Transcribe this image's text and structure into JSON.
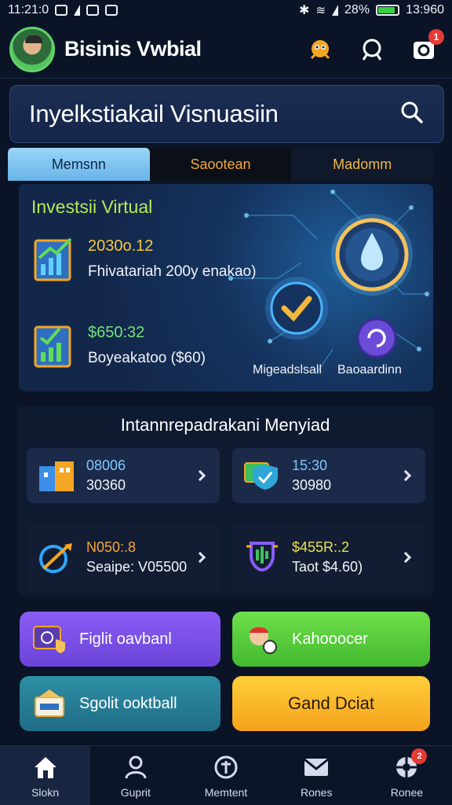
{
  "status_bar": {
    "time": "11:21:0",
    "battery": "28%",
    "clock_right": "13:960"
  },
  "app_bar": {
    "title": "Bisinis Vwbial",
    "notification_count": "1"
  },
  "search": {
    "title": "Inyelkstiakail Visnuasiin"
  },
  "tabs": [
    {
      "label": "Memsnn"
    },
    {
      "label": "Saootean"
    },
    {
      "label": "Madomm"
    }
  ],
  "investment": {
    "title": "Investsii Virtual",
    "items": [
      {
        "amount": "2030o.12",
        "desc": "Fhivatariah 200y enakao)"
      },
      {
        "amount": "$650:32",
        "desc": "Boyeakatoo ($60)"
      }
    ],
    "labels": [
      "Migeadslsall",
      "Baoaardinn"
    ]
  },
  "section": {
    "title": "Intannrepadrakani Menyiad",
    "cards": [
      {
        "line1": "08006",
        "line2": "30360"
      },
      {
        "line1": "15:30",
        "line2": "30980"
      },
      {
        "line1": "N050:.8",
        "line2": "Seaipe: V05500"
      },
      {
        "line1": "$455R:.2",
        "line2": "Taot $4.60)"
      }
    ]
  },
  "actions": {
    "purple": "Figlit oavbanl",
    "green": "Kahooocer",
    "teal": "Sgolit ooktball",
    "orange": "Gand Dciat"
  },
  "bottom_nav": [
    {
      "label": "Slokn"
    },
    {
      "label": "Guprit"
    },
    {
      "label": "Memtent"
    },
    {
      "label": "Rones"
    },
    {
      "label": "Ronee",
      "badge": "2"
    }
  ]
}
